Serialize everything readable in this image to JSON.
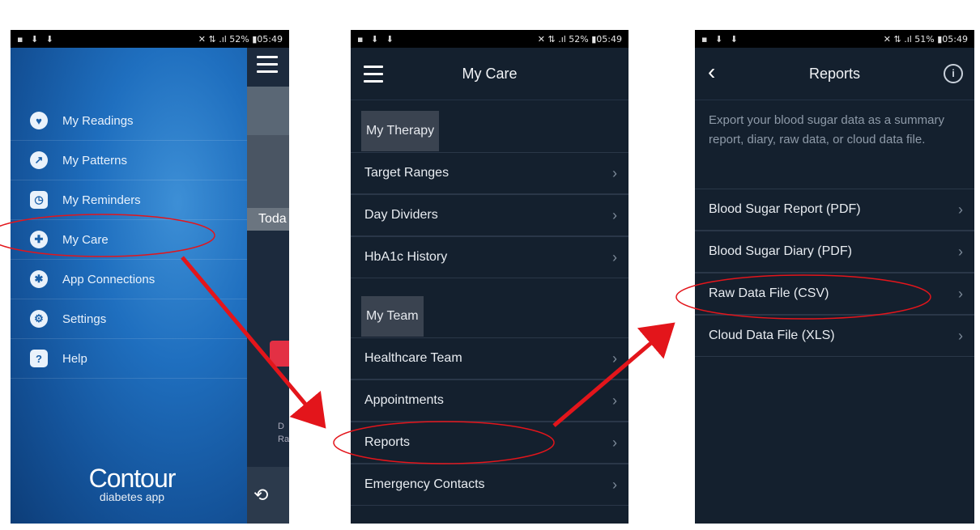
{
  "status_bar": {
    "screen1": {
      "left_icons": "▪ ⬇ ⬇",
      "right": "✕ ⇅ .ıl 52% ▮05:49"
    },
    "screen2": {
      "left_icons": "▪ ⬇ ⬇",
      "right": "✕ ⇅ .ıl 52% ▮05:49"
    },
    "screen3": {
      "left_icons": "▪ ⬇ ⬇",
      "right": "✕ ⇅ .ıl 51% ▮05:49"
    }
  },
  "screen1": {
    "menu": [
      {
        "label": "My Readings",
        "icon": "readings-icon"
      },
      {
        "label": "My Patterns",
        "icon": "patterns-icon"
      },
      {
        "label": "My Reminders",
        "icon": "reminders-icon"
      },
      {
        "label": "My Care",
        "icon": "care-icon"
      },
      {
        "label": "App Connections",
        "icon": "connections-icon"
      },
      {
        "label": "Settings",
        "icon": "settings-icon"
      },
      {
        "label": "Help",
        "icon": "help-icon"
      }
    ],
    "peek_text": "Toda",
    "peek_small": "D\nRa",
    "logo_main": "Contour",
    "logo_sub": "diabetes app"
  },
  "screen2": {
    "title": "My Care",
    "section_therapy": "My Therapy",
    "therapy_items": [
      "Target Ranges",
      "Day Dividers",
      "HbA1c History"
    ],
    "section_team": "My Team",
    "team_items": [
      "Healthcare Team",
      "Appointments",
      "Reports",
      "Emergency Contacts"
    ]
  },
  "screen3": {
    "title": "Reports",
    "description": "Export your blood sugar data as a summary report, diary, raw data, or cloud data file.",
    "items": [
      "Blood Sugar Report (PDF)",
      "Blood Sugar Diary (PDF)",
      "Raw Data File (CSV)",
      "Cloud Data File (XLS)"
    ]
  },
  "colors": {
    "annotation": "#e3151b",
    "menu_bg": "#1f6fbf",
    "dark_bg": "#14202e"
  }
}
